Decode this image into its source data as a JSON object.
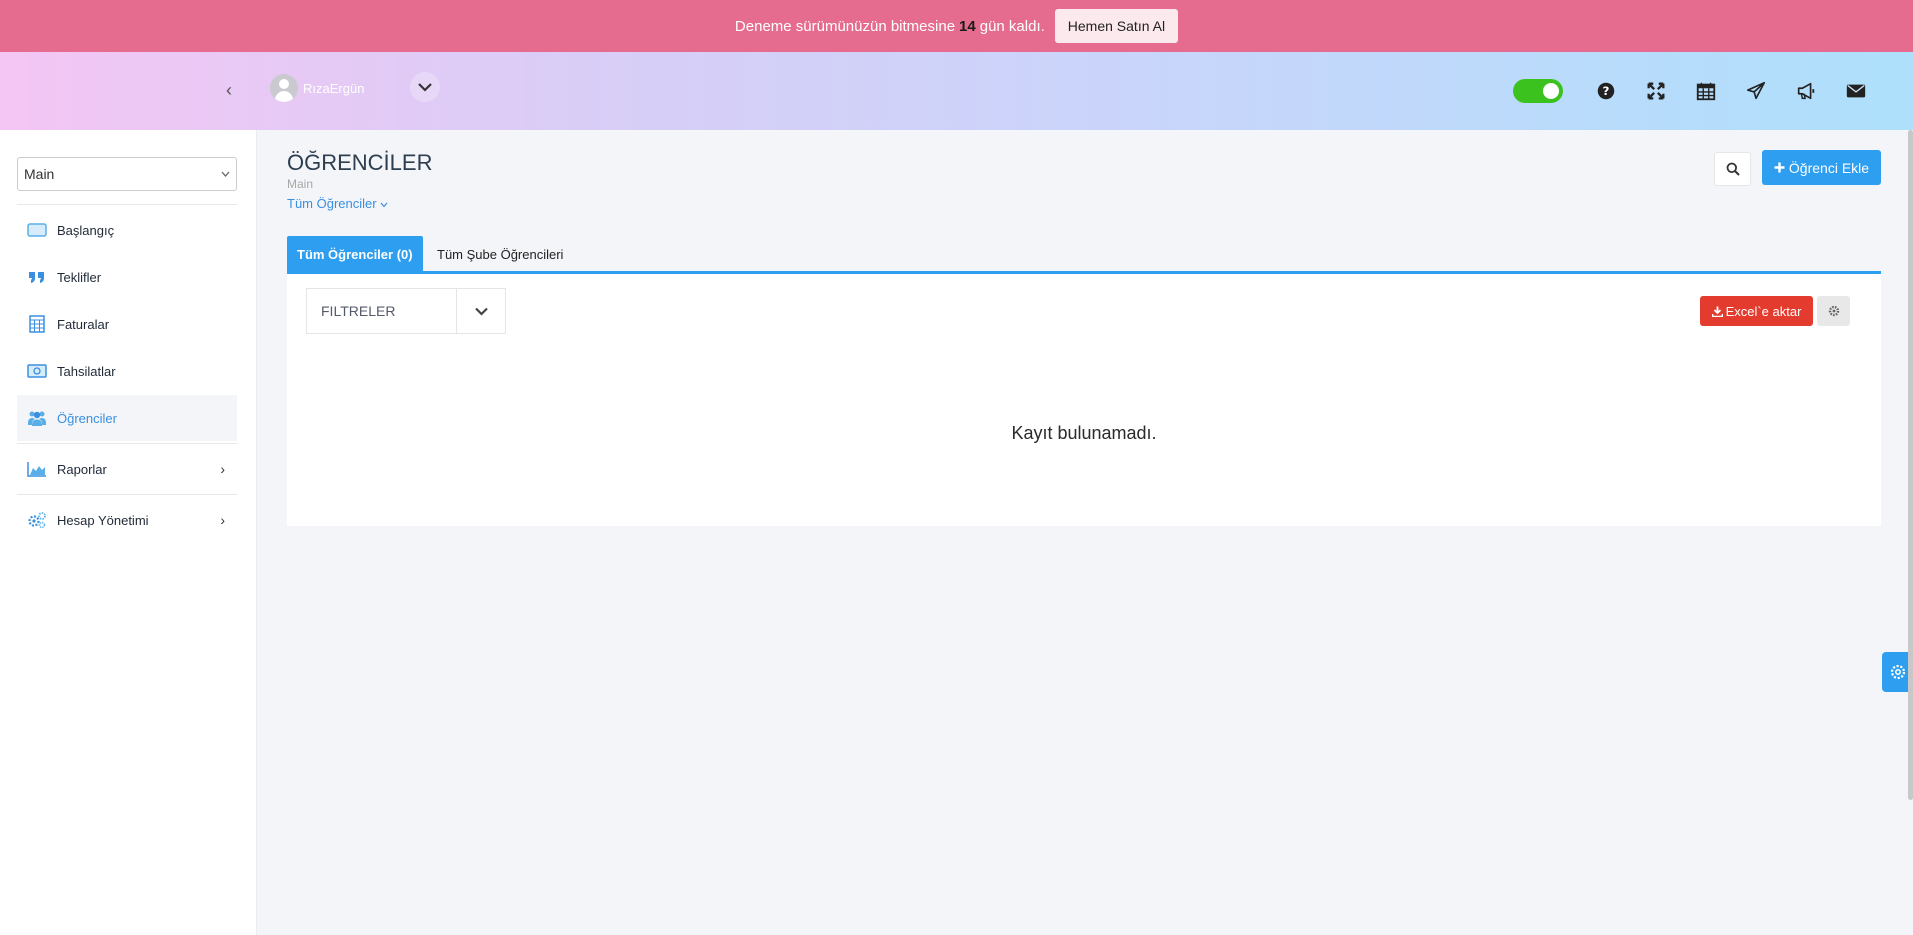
{
  "banner": {
    "text_before": "Deneme sürümünüzün bitmesine",
    "days": "14",
    "text_after": "gün kaldı.",
    "button": "Hemen Satın Al"
  },
  "header": {
    "username": "RızaErgün",
    "icons": [
      "question-circle-icon",
      "expand-icon",
      "calendar-icon",
      "paper-plane-icon",
      "megaphone-icon",
      "envelope-icon"
    ],
    "toggle_on": true
  },
  "sidebar": {
    "branch_select": "Main",
    "items": [
      {
        "label": "Başlangıç",
        "icon": "monitor-icon"
      },
      {
        "label": "Teklifler",
        "icon": "quote-icon"
      },
      {
        "label": "Faturalar",
        "icon": "calculator-icon"
      },
      {
        "label": "Tahsilatlar",
        "icon": "money-icon"
      },
      {
        "label": "Öğrenciler",
        "icon": "users-icon",
        "active": true
      },
      {
        "label": "Raporlar",
        "icon": "chart-area-icon"
      },
      {
        "label": "Hesap Yönetimi",
        "icon": "cogs-icon"
      }
    ]
  },
  "page": {
    "title": "ÖĞRENCİLER",
    "subtitle": "Main",
    "filter_dropdown": "Tüm Öğrenciler",
    "add_button": "Öğrenci Ekle"
  },
  "tabs": [
    {
      "label": "Tüm Öğrenciler (0)",
      "active": true
    },
    {
      "label": "Tüm Şube Öğrencileri",
      "active": false
    }
  ],
  "panel": {
    "filters_label": "FILTRELER",
    "excel_button": "Excel`e aktar",
    "empty_message": "Kayıt bulunamadı."
  },
  "colors": {
    "banner": "#e56c8f",
    "primary": "#2d9ef0",
    "danger": "#e33b2e",
    "toggle": "#3cc21f"
  }
}
